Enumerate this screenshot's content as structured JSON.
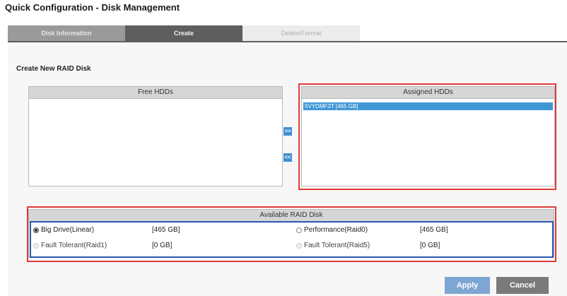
{
  "window": {
    "title": "Quick Configuration - Disk Management"
  },
  "tabs": [
    {
      "label": "Disk Information"
    },
    {
      "label": "Create"
    },
    {
      "label": "Delete/Format"
    }
  ],
  "section": {
    "title": "Create New RAID Disk"
  },
  "free_hdds": {
    "header": "Free HDDs",
    "items": []
  },
  "assigned_hdds": {
    "header": "Assigned HDDs",
    "items": [
      {
        "label": "5VYDMF3T [465 GB]",
        "selected": true
      }
    ]
  },
  "arrows": {
    "add": ">>",
    "remove": "<<"
  },
  "raid": {
    "header": "Available RAID Disk",
    "options": [
      {
        "label": "Big Drive(Linear)",
        "size": "[465 GB]",
        "selected": true,
        "enabled": true
      },
      {
        "label": "Performance(Raid0)",
        "size": "[465 GB]",
        "selected": false,
        "enabled": true
      },
      {
        "label": "Fault Tolerant(Raid1)",
        "size": "[0 GB]",
        "selected": false,
        "enabled": false
      },
      {
        "label": "Fault Tolerant(Raid5)",
        "size": "[0 GB]",
        "selected": false,
        "enabled": false
      }
    ]
  },
  "buttons": {
    "apply": "Apply",
    "cancel": "Cancel"
  },
  "colors": {
    "accent": "#3f97d6",
    "highlight_red": "#e23a3a",
    "highlight_blue": "#2a57b0"
  }
}
